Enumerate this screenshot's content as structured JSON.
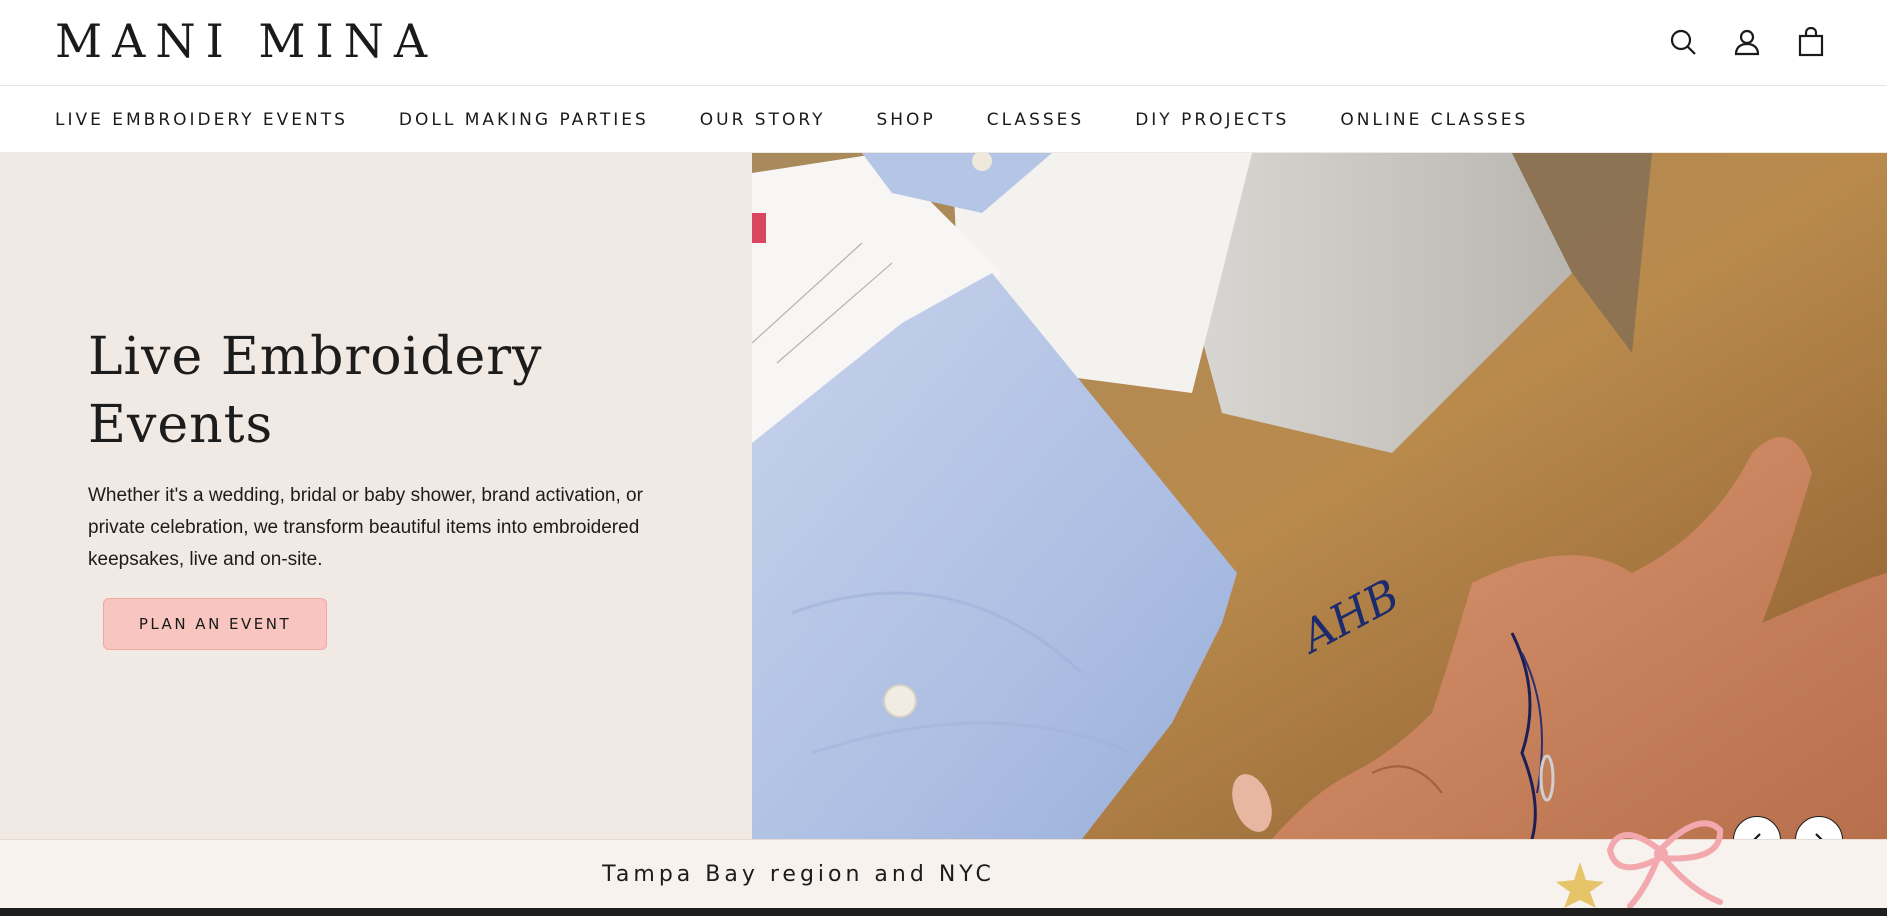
{
  "header": {
    "logo": "MANI MINA",
    "icons": [
      "search-icon",
      "account-icon",
      "cart-icon"
    ]
  },
  "nav": {
    "items": [
      {
        "label": "LIVE EMBROIDERY EVENTS"
      },
      {
        "label": "DOLL MAKING PARTIES"
      },
      {
        "label": "OUR STORY"
      },
      {
        "label": "SHOP"
      },
      {
        "label": "CLASSES"
      },
      {
        "label": "DIY PROJECTS"
      },
      {
        "label": "ONLINE CLASSES"
      }
    ]
  },
  "hero": {
    "title_line1": "Live Embroidery",
    "title_line2": "Events",
    "description": "Whether it's a wedding, bridal or baby shower, brand activation, or private celebration, we transform beautiful items into embroidered keepsakes, live and on-site.",
    "cta_label": "PLAN AN EVENT",
    "image_monogram": "AHB"
  },
  "slider": {
    "prev_icon": "chevron-left-icon",
    "next_icon": "chevron-right-icon"
  },
  "announcement": {
    "text": "Tampa Bay region and NYC"
  },
  "colors": {
    "hero_bg": "#f1e9e4",
    "cta_bg": "#f8c5c0",
    "strip_bg": "#f7f2ee",
    "text": "#1c1c1c"
  }
}
